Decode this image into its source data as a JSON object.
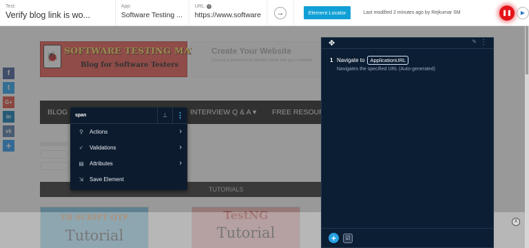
{
  "toolbar": {
    "test_label": "Test:",
    "test_value": "Verify blog link is wo...",
    "app_label": "App:",
    "app_value": "Software Testing ...",
    "url_label": "URL:",
    "url_info": "i",
    "url_value": "https://www.softwarete",
    "go_arrow": "→",
    "element_locator": "Element Locator",
    "last_modified": "Last modified 2 minutes ago by Rejkumar SM",
    "pause_glyph": "❚❚",
    "play_glyph": "▶"
  },
  "site": {
    "social": [
      {
        "name": "facebook",
        "glyph": "f"
      },
      {
        "name": "twitter",
        "glyph": "t"
      },
      {
        "name": "google-plus",
        "glyph": "G+"
      },
      {
        "name": "linkedin",
        "glyph": "in"
      },
      {
        "name": "vk",
        "glyph": "vk"
      },
      {
        "name": "share",
        "glyph": "+"
      }
    ],
    "logo_title": "SOFTWARE TESTING MATERIAL",
    "logo_subtitle": "Blog for Software Testers",
    "ad_title": "Create Your Website",
    "ad_text": "Choose a professional domain name and get a website",
    "nav_blog": "BLOG",
    "nav_interview": "INTERVIEW Q & A ▾",
    "nav_free": "FREE RESOURC",
    "tutorials": "TUTORIALS",
    "card_vb_top": "VB SCRIPT QTP",
    "card_vb_bottom": "Tutorial",
    "card_tng_top": "TestNG",
    "card_tng_bottom": "Tutorial",
    "close_ad": "X"
  },
  "context_menu": {
    "tag": "span",
    "items": [
      {
        "label": "Actions",
        "icon": "⚲",
        "has_submenu": true
      },
      {
        "label": "Validations",
        "icon": "✓",
        "has_submenu": true
      },
      {
        "label": "Attributes",
        "icon": "▤",
        "has_submenu": true
      },
      {
        "label": "Save Element",
        "icon": "⇲",
        "has_submenu": false
      }
    ],
    "submenu_arrow": "›"
  },
  "panel": {
    "step_number": "1",
    "step_action": "Navigate to",
    "step_variable": "ApplicationURL",
    "step_description": "Navigates the specified URL (Auto-generated)"
  },
  "colors": {
    "accent": "#11a0d6",
    "record_red": "#e4141a",
    "panel_bg": "#0b1e33"
  }
}
